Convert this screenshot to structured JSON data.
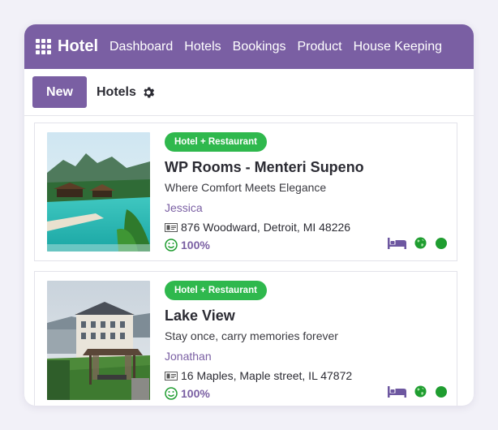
{
  "navbar": {
    "brand": "Hotel",
    "items": [
      "Dashboard",
      "Hotels",
      "Bookings",
      "Product",
      "House Keeping"
    ]
  },
  "control": {
    "new_label": "New",
    "breadcrumb": "Hotels"
  },
  "cards": [
    {
      "tag": "Hotel + Restaurant",
      "title": "WP Rooms - Menteri Supeno",
      "tagline": "Where Comfort Meets Elegance",
      "manager": "Jessica",
      "address": "876 Woodward, Detroit, MI 48226",
      "rating": "100%"
    },
    {
      "tag": "Hotel + Restaurant",
      "title": "Lake View",
      "tagline": "Stay once, carry memories forever",
      "manager": "Jonathan",
      "address": "16 Maples, Maple street, IL 47872",
      "rating": "100%"
    }
  ],
  "colors": {
    "brand": "#7a5fa3",
    "tag": "#2fb84d",
    "status": "#1f9d30"
  },
  "icons": [
    "apps-icon",
    "gear-icon",
    "id-card-icon",
    "smile-icon",
    "bed-icon",
    "globe-icon",
    "status-dot"
  ]
}
